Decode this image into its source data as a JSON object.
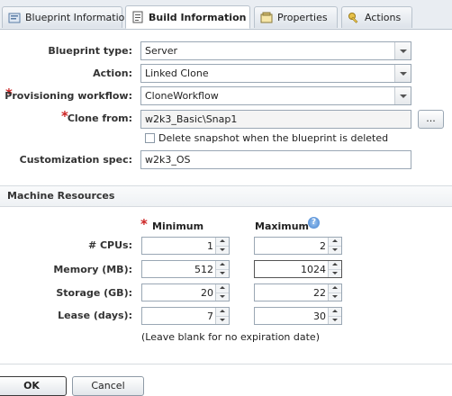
{
  "tabs": [
    {
      "label": "Blueprint Information",
      "icon": "blueprint-info-icon"
    },
    {
      "label": "Build Information",
      "icon": "build-info-icon"
    },
    {
      "label": "Properties",
      "icon": "properties-icon"
    },
    {
      "label": "Actions",
      "icon": "actions-key-icon"
    }
  ],
  "active_tab": "Build Information",
  "form": {
    "blueprint_type": {
      "label": "Blueprint type:",
      "value": "Server"
    },
    "action": {
      "label": "Action:",
      "value": "Linked Clone"
    },
    "provisioning_workflow": {
      "label": "Provisioning workflow:",
      "value": "CloneWorkflow",
      "required": true
    },
    "clone_from": {
      "label": "Clone from:",
      "value": "w2k3_Basic\\Snap1",
      "required": true,
      "browse_label": "..."
    },
    "delete_snapshot": {
      "label": "Delete snapshot when the blueprint is deleted",
      "checked": false
    },
    "customization_spec": {
      "label": "Customization spec:",
      "value": "w2k3_OS"
    }
  },
  "machine_resources": {
    "title": "Machine Resources",
    "minimum_header": "Minimum",
    "maximum_header": "Maximum",
    "help_glyph": "?",
    "rows": [
      {
        "label": "# CPUs:",
        "min": "1",
        "max": "2"
      },
      {
        "label": "Memory (MB):",
        "min": "512",
        "max": "1024"
      },
      {
        "label": "Storage (GB):",
        "min": "20",
        "max": "22"
      },
      {
        "label": "Lease (days):",
        "min": "7",
        "max": "30"
      }
    ],
    "lease_note": "(Leave blank for no expiration date)"
  },
  "footer": {
    "ok_label": "OK",
    "cancel_label": "Cancel"
  },
  "colors": {
    "required": "#cc2222",
    "border": "#9aa7b4",
    "tabbar": "#e9edf2"
  }
}
